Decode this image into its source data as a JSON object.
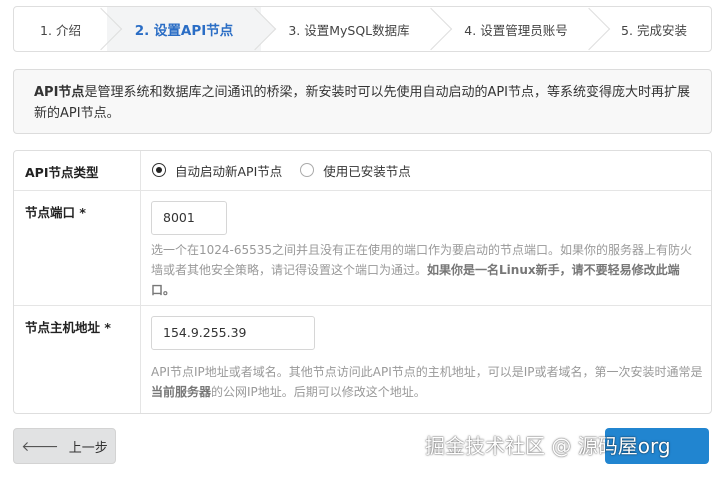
{
  "steps": [
    {
      "label": "1. 介绍"
    },
    {
      "label": "2. 设置API节点"
    },
    {
      "label": "3. 设置MySQL数据库"
    },
    {
      "label": "4. 设置管理员账号"
    },
    {
      "label": "5. 完成安装"
    }
  ],
  "notice": {
    "bold": "API节点",
    "text": "是管理系统和数据库之间通讯的桥梁，新安装时可以先使用自动启动的API节点，等系统变得庞大时再扩展新的API节点。"
  },
  "form": {
    "node_type": {
      "label": "API节点类型",
      "options": [
        "自动启动新API节点",
        "使用已安装节点"
      ],
      "selected": "自动启动新API节点"
    },
    "port": {
      "label": "节点端口 *",
      "value": "8001",
      "help": "选一个在1024-65535之间并且没有正在使用的端口作为要启动的节点端口。如果你的服务器上有防火墙或者其他安全策略，请记得设置这个端口为通过。",
      "help_bold": "如果你是一名Linux新手，请不要轻易修改此端口。"
    },
    "host": {
      "label": "节点主机地址 *",
      "value": "154.9.255.39",
      "help_pre": "API节点IP地址或者域名。其他节点访问此API节点的主机地址，可以是IP或者域名，第一次安装时通常是",
      "help_bold": "当前服务器",
      "help_post": "的公网IP地址。后期可以修改这个地址。"
    }
  },
  "buttons": {
    "prev": "上一步"
  },
  "watermark": "掘金技术社区 @ 源码屋org"
}
